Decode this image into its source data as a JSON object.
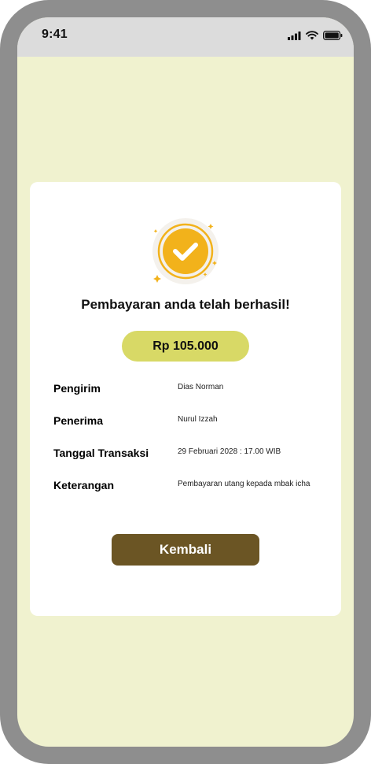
{
  "status_bar": {
    "time": "9:41"
  },
  "colors": {
    "background": "#f0f2cf",
    "amount_pill": "#d8d966",
    "badge_gold": "#f2b21b",
    "back_button": "#6b5524"
  },
  "success": {
    "icon": "check-badge-icon",
    "title": "Pembayaran anda telah berhasil!",
    "amount": "Rp 105.000"
  },
  "details": [
    {
      "label": "Pengirim",
      "value": "Dias Norman"
    },
    {
      "label": "Penerima",
      "value": "Nurul Izzah"
    },
    {
      "label": "Tanggal Transaksi",
      "value": "29 Februari 2028 : 17.00 WIB"
    },
    {
      "label": "Keterangan",
      "value": "Pembayaran utang kepada mbak icha"
    }
  ],
  "actions": {
    "back_label": "Kembali"
  }
}
